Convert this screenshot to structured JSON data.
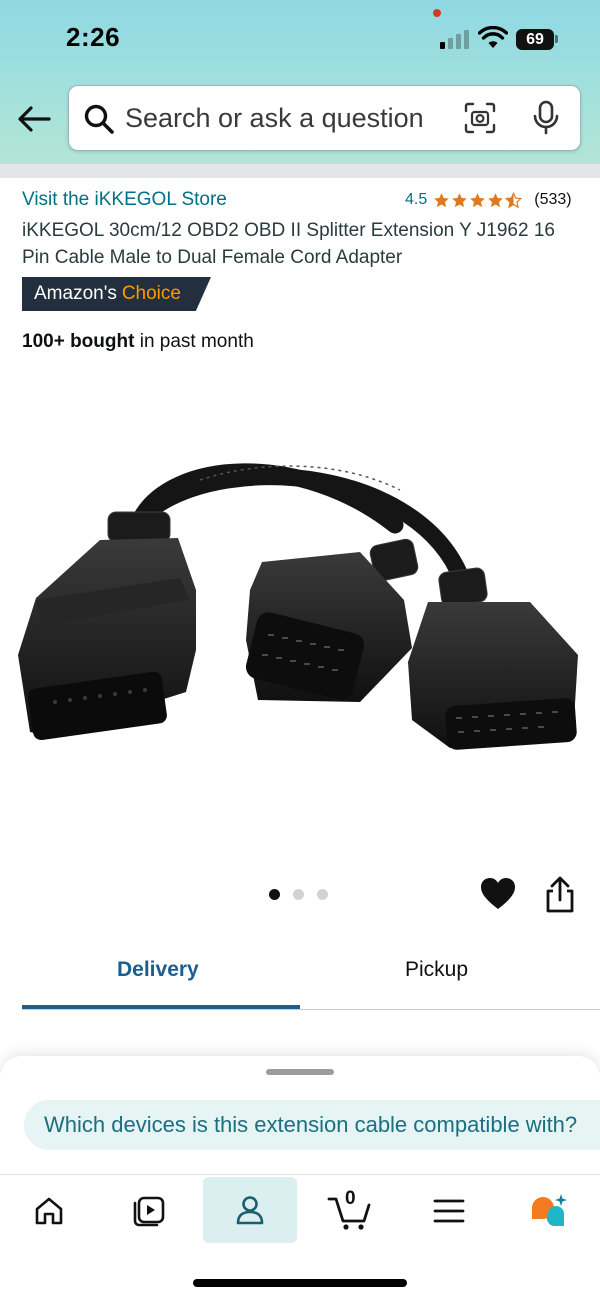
{
  "status_bar": {
    "time": "2:26",
    "battery": "69"
  },
  "search": {
    "placeholder": "Search or ask a question"
  },
  "product": {
    "store_link": "Visit the iKKEGOL Store",
    "rating_value": "4.5",
    "rating_count": "(533)",
    "stars_filled": 4.5,
    "title": "iKKEGOL 30cm/12 OBD2 OBD II Splitter Extension Y J1962 16 Pin Cable Male to Dual Female Cord Adapter",
    "badge_prefix": "Amazon's",
    "badge_accent": "Choice",
    "bought_bold": "100+ bought",
    "bought_rest": "in past month",
    "image_description_icon": "obd2-splitter-cable-image",
    "image_count": 3,
    "active_image_index": 0
  },
  "tabs": {
    "delivery": "Delivery",
    "pickup": "Pickup",
    "active": "delivery"
  },
  "assistant": {
    "suggestion": "Which devices is this extension cable compatible with?"
  },
  "bottom_nav": {
    "items": [
      {
        "name": "home",
        "icon": "home-icon"
      },
      {
        "name": "inspire",
        "icon": "play-video-icon"
      },
      {
        "name": "account",
        "icon": "person-icon"
      },
      {
        "name": "cart",
        "icon": "cart-icon"
      },
      {
        "name": "menu",
        "icon": "hamburger-menu-icon"
      },
      {
        "name": "rufus",
        "icon": "rufus-assistant-icon"
      }
    ],
    "active": "account",
    "cart_count": "0"
  },
  "colors": {
    "link": "#007185",
    "star": "#de7921",
    "badge_bg": "#232f3e",
    "badge_accent": "#ff9900",
    "tab_active": "#1a5f8f",
    "header_gradient_top": "#8fd8e3",
    "header_gradient_bottom": "#b6e6d3"
  }
}
